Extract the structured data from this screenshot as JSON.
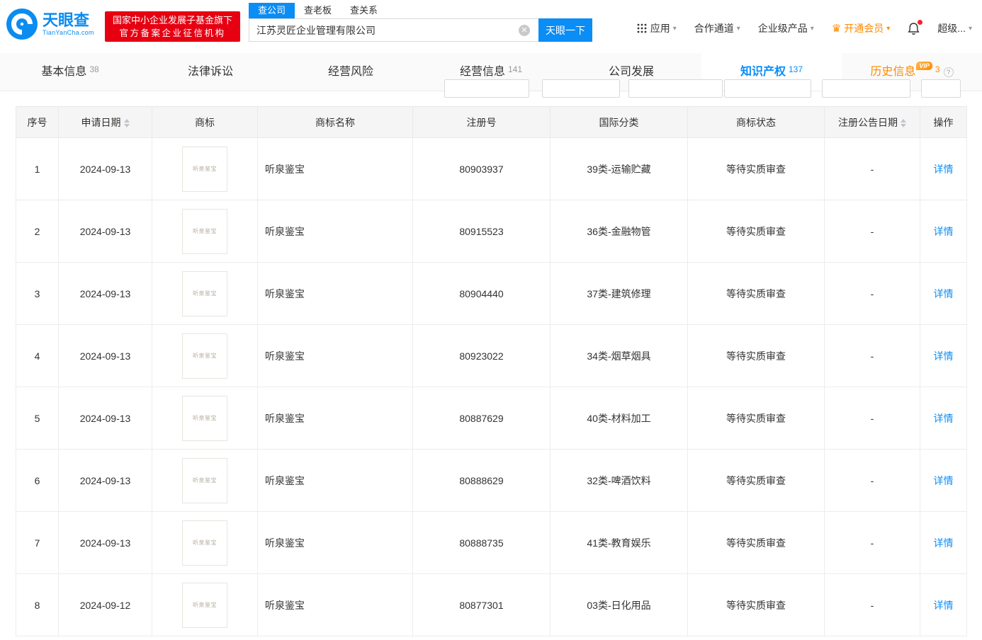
{
  "colors": {
    "brand_blue": "#0a8df5",
    "badge_red": "#e60012",
    "vip_orange": "#ff8a00"
  },
  "header": {
    "logo_cn": "天眼查",
    "logo_en": "TianYanCha.com",
    "gov_badge_line1": "国家中小企业发展子基金旗下",
    "gov_badge_line2": "官方备案企业征信机构",
    "search_tabs": [
      {
        "label": "查公司"
      },
      {
        "label": "查老板"
      },
      {
        "label": "查关系"
      }
    ],
    "search_value": "江苏灵匠企业管理有限公司",
    "clear_glyph": "✕",
    "search_button": "天眼一下",
    "nav": {
      "apps": "应用",
      "cooperation": "合作通道",
      "enterprise": "企业级产品",
      "vip": "开通会员",
      "more": "超级..."
    }
  },
  "tabs": [
    {
      "label": "基本信息",
      "count": "38"
    },
    {
      "label": "法律诉讼"
    },
    {
      "label": "经营风险"
    },
    {
      "label": "经营信息",
      "count": "141"
    },
    {
      "label": "公司发展"
    },
    {
      "label": "知识产权",
      "count": "137"
    },
    {
      "label": "历史信息",
      "count": "3",
      "vip_tag": "VIP",
      "help": "?"
    }
  ],
  "table": {
    "columns": [
      "序号",
      "申请日期",
      "商标",
      "商标名称",
      "注册号",
      "国际分类",
      "商标状态",
      "注册公告日期",
      "操作"
    ],
    "rows": [
      {
        "no": "1",
        "date": "2024-09-13",
        "name": "听泉鉴宝",
        "reg_no": "80903937",
        "intl_class": "39类-运输贮藏",
        "status": "等待实质审查",
        "announce": "-",
        "action": "详情"
      },
      {
        "no": "2",
        "date": "2024-09-13",
        "name": "听泉鉴宝",
        "reg_no": "80915523",
        "intl_class": "36类-金融物管",
        "status": "等待实质审查",
        "announce": "-",
        "action": "详情"
      },
      {
        "no": "3",
        "date": "2024-09-13",
        "name": "听泉鉴宝",
        "reg_no": "80904440",
        "intl_class": "37类-建筑修理",
        "status": "等待实质审查",
        "announce": "-",
        "action": "详情"
      },
      {
        "no": "4",
        "date": "2024-09-13",
        "name": "听泉鉴宝",
        "reg_no": "80923022",
        "intl_class": "34类-烟草烟具",
        "status": "等待实质审查",
        "announce": "-",
        "action": "详情"
      },
      {
        "no": "5",
        "date": "2024-09-13",
        "name": "听泉鉴宝",
        "reg_no": "80887629",
        "intl_class": "40类-材料加工",
        "status": "等待实质审查",
        "announce": "-",
        "action": "详情"
      },
      {
        "no": "6",
        "date": "2024-09-13",
        "name": "听泉鉴宝",
        "reg_no": "80888629",
        "intl_class": "32类-啤酒饮料",
        "status": "等待实质审查",
        "announce": "-",
        "action": "详情"
      },
      {
        "no": "7",
        "date": "2024-09-13",
        "name": "听泉鉴宝",
        "reg_no": "80888735",
        "intl_class": "41类-教育娱乐",
        "status": "等待实质审查",
        "announce": "-",
        "action": "详情"
      },
      {
        "no": "8",
        "date": "2024-09-12",
        "name": "听泉鉴宝",
        "reg_no": "80877301",
        "intl_class": "03类-日化用品",
        "status": "等待实质审查",
        "announce": "-",
        "action": "详情"
      }
    ]
  }
}
